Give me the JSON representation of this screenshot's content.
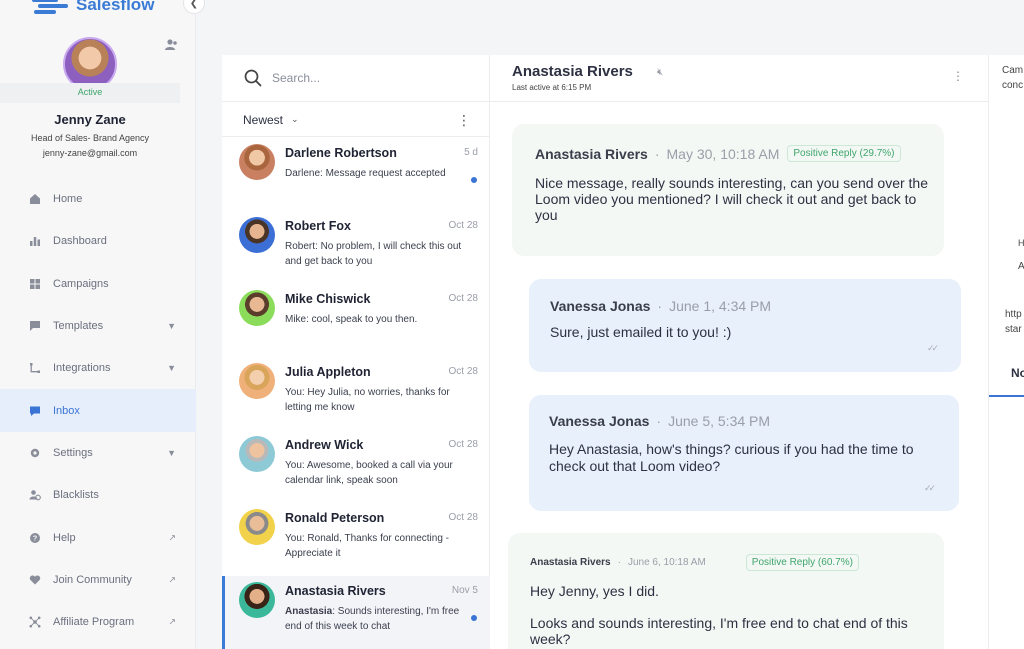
{
  "app": {
    "name": "Salesflow"
  },
  "profile": {
    "name": "Jenny Zane",
    "status": "Active",
    "role": "Head of Sales- Brand Agency",
    "email": "jenny-zane@gmail.com"
  },
  "nav": {
    "items": [
      {
        "label": "Home",
        "icon": "home-icon"
      },
      {
        "label": "Dashboard",
        "icon": "chart-icon"
      },
      {
        "label": "Campaigns",
        "icon": "grid-icon"
      },
      {
        "label": "Templates",
        "icon": "chat-icon"
      },
      {
        "label": "Integrations",
        "icon": "integration-icon"
      },
      {
        "label": "Inbox",
        "icon": "inbox-icon"
      },
      {
        "label": "Settings",
        "icon": "gear-icon"
      },
      {
        "label": "Blacklists",
        "icon": "block-icon"
      },
      {
        "label": "Help",
        "icon": "help-icon"
      },
      {
        "label": "Join Community",
        "icon": "heart-icon"
      },
      {
        "label": "Affiliate Program",
        "icon": "network-icon"
      }
    ],
    "active": "Inbox"
  },
  "search": {
    "placeholder": "Search..."
  },
  "sort": {
    "label": "Newest"
  },
  "conversations": [
    {
      "name": "Darlene Robertson",
      "time": "5 d",
      "preview": "Darlene: Message request accepted",
      "unread": true,
      "avatar_color": "#c98060"
    },
    {
      "name": "Robert Fox",
      "time": "Oct 28",
      "preview": "Robert: No problem, I will check this out and get back to you",
      "unread": false,
      "avatar_color": "#3b6fd6"
    },
    {
      "name": "Mike Chiswick",
      "time": "Oct 28",
      "preview": "Mike: cool, speak to you then.",
      "unread": false,
      "avatar_color": "#8bdc5a"
    },
    {
      "name": "Julia Appleton",
      "time": "Oct 28",
      "preview": "You: Hey Julia, no worries, thanks for letting me know",
      "unread": false,
      "avatar_color": "#f0b07a"
    },
    {
      "name": "Andrew Wick",
      "time": "Oct 28",
      "preview": "You: Awesome, booked a call via your calendar link, speak soon",
      "unread": false,
      "avatar_color": "#8ec9d6"
    },
    {
      "name": "Ronald Peterson",
      "time": "Oct 28",
      "preview": "You: Ronald, Thanks for connecting - Appreciate it",
      "unread": false,
      "avatar_color": "#f2d24a"
    },
    {
      "name": "Anastasia Rivers",
      "time": "Nov 5",
      "preview_sender": "Anastasia",
      "preview": ": Sounds interesting, I'm free end of this week to chat",
      "unread": true,
      "selected": true,
      "avatar_color": "#3bb89a"
    }
  ],
  "chat": {
    "contact_name": "Anastasia Rivers",
    "last_active": "Last active at 6:15 PM",
    "messages": [
      {
        "direction": "in",
        "sender": "Anastasia Rivers",
        "time": "May 30, 10:18 AM",
        "tag": "Positive Reply (29.7%)",
        "text": "Nice message, really sounds interesting,  can you send over the Loom video you mentioned? I will check it out and get back to you"
      },
      {
        "direction": "out",
        "sender": "Vanessa Jonas",
        "time": "June 1, 4:34 PM",
        "text": "Sure, just emailed it to you! :)"
      },
      {
        "direction": "out",
        "sender": "Vanessa Jonas",
        "time": "June 5, 5:34 PM",
        "text": "Hey Anastasia, how's things? curious if you had the time to check out that Loom video?"
      },
      {
        "direction": "in",
        "sender": "Anastasia Rivers",
        "time": "June 6, 10:18 AM",
        "tag": "Positive Reply (60.7%)",
        "text": "Hey Jenny, yes I did.",
        "text2": "Looks and sounds interesting,  I'm free end to chat end of this week?"
      }
    ]
  },
  "right_panel": {
    "line1": "Cam",
    "line2": "conc",
    "line3": "H",
    "line4": "A",
    "line5": "http",
    "line6": "star",
    "tab": "No"
  },
  "colors": {
    "accent": "#3a74d4",
    "positive": "#3fa56b",
    "in_bubble": "#f3f8f5",
    "out_bubble": "#e8f0fc"
  }
}
